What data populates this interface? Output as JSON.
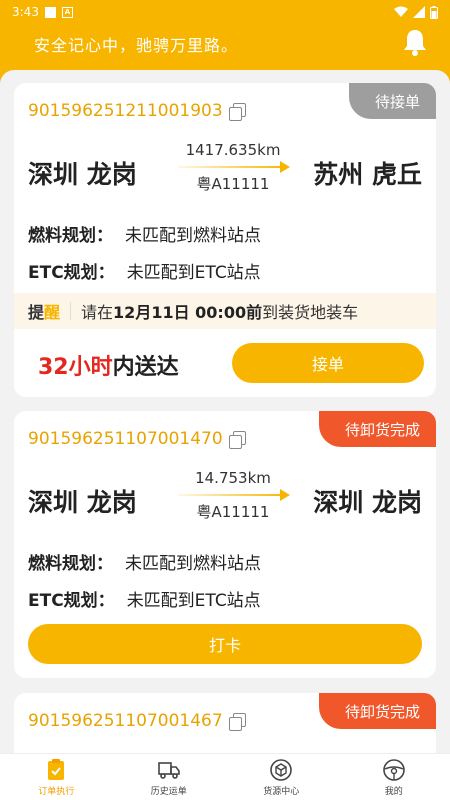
{
  "status_bar": {
    "time": "3:43",
    "notif_letter": "A"
  },
  "header": {
    "slogan": "安全记心中，驰骋万里路。"
  },
  "orders": [
    {
      "order_no": "901596251211001903",
      "status": "待接单",
      "from": "深圳 龙岗",
      "to": "苏州 虎丘",
      "distance": "1417.635km",
      "plate": "粤A11111",
      "fuel_label": "燃料规划：",
      "fuel_value": "未匹配到燃料站点",
      "etc_label": "ETC规划：",
      "etc_value": "未匹配到ETC站点",
      "reminder": {
        "t1": "提",
        "t2": "醒",
        "pre": "请在",
        "date": "12月11日 00:00前",
        "post": "到装货地装车"
      },
      "deliver_red": "32小时",
      "deliver_black": "内送达",
      "action": "接单"
    },
    {
      "order_no": "901596251107001470",
      "status": "待卸货完成",
      "from": "深圳 龙岗",
      "to": "深圳 龙岗",
      "distance": "14.753km",
      "plate": "粤A11111",
      "fuel_label": "燃料规划：",
      "fuel_value": "未匹配到燃料站点",
      "etc_label": "ETC规划：",
      "etc_value": "未匹配到ETC站点",
      "action": "打卡"
    },
    {
      "order_no": "901596251107001467",
      "status": "待卸货完成"
    }
  ],
  "tabs": [
    {
      "label": "订单执行",
      "icon": "order-icon"
    },
    {
      "label": "历史运单",
      "icon": "truck-icon"
    },
    {
      "label": "货源中心",
      "icon": "cargo-box-icon"
    },
    {
      "label": "我的",
      "icon": "steering-wheel-icon"
    }
  ],
  "colors": {
    "brand": "#f7b500",
    "status_grey": "#9e9e9e",
    "status_orange": "#f0582b",
    "deliver_red": "#e3281f"
  }
}
